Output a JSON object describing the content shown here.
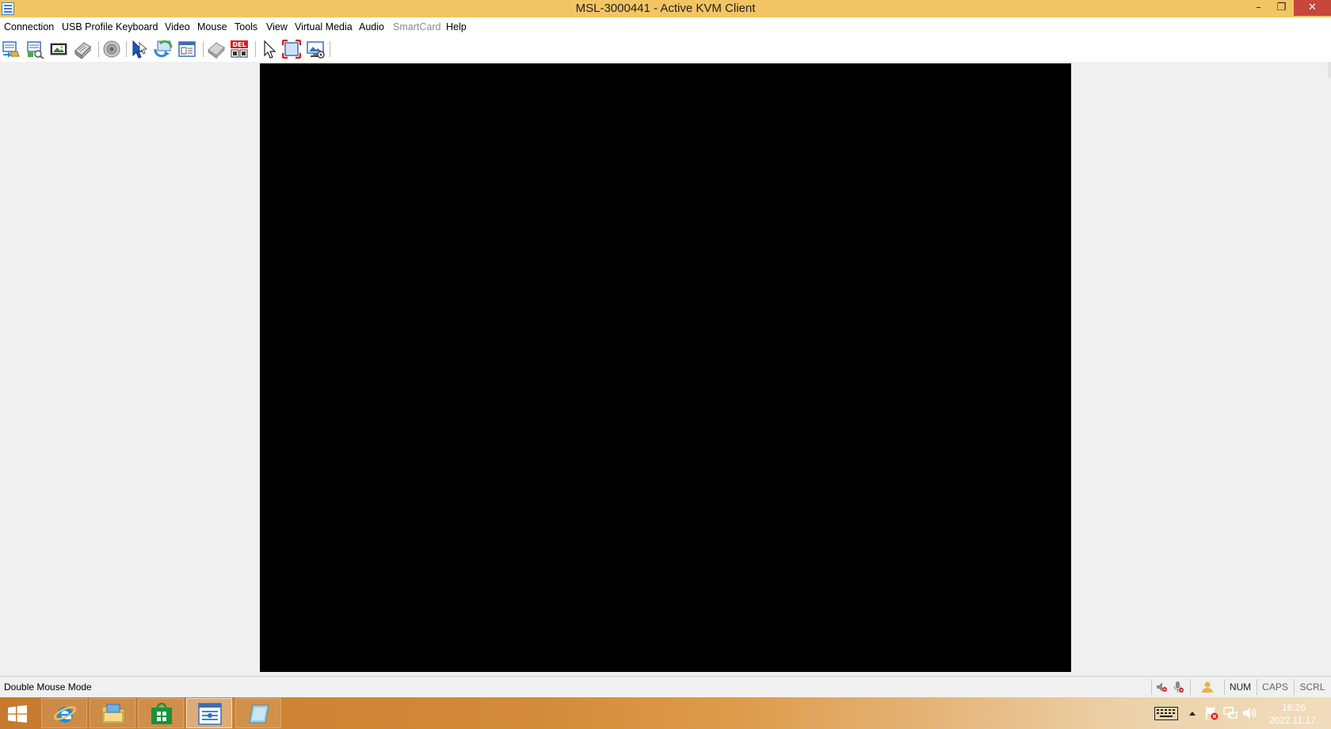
{
  "window": {
    "title": "MSL-3000441 - Active KVM Client",
    "controls": {
      "minimize": "–",
      "maximize": "❐",
      "close": "✕"
    }
  },
  "menu": [
    {
      "id": "connection",
      "label": "Connection",
      "enabled": true
    },
    {
      "id": "usb-profile",
      "label": "USB Profile",
      "enabled": true
    },
    {
      "id": "keyboard",
      "label": "Keyboard",
      "enabled": true
    },
    {
      "id": "video",
      "label": "Video",
      "enabled": true
    },
    {
      "id": "mouse",
      "label": "Mouse",
      "enabled": true
    },
    {
      "id": "tools",
      "label": "Tools",
      "enabled": true
    },
    {
      "id": "view",
      "label": "View",
      "enabled": true
    },
    {
      "id": "virtual-media",
      "label": "Virtual Media",
      "enabled": true
    },
    {
      "id": "audio",
      "label": "Audio",
      "enabled": true
    },
    {
      "id": "smartcard",
      "label": "SmartCard",
      "enabled": false
    },
    {
      "id": "help",
      "label": "Help",
      "enabled": true
    }
  ],
  "toolbar": {
    "icons": [
      "connection-icon",
      "usb-profile-icon",
      "video-settings-icon",
      "keyboard-macro-icon",
      "audio-icon",
      "mouse-mode-icon",
      "refresh-video-icon",
      "calibrate-icon",
      "virtual-media-icon",
      "ctrl-alt-del-icon",
      "single-cursor-icon",
      "full-screen-icon",
      "capture-screen-icon"
    ],
    "ctrl_alt_del_text": "DEL"
  },
  "status": {
    "message": "Double Mouse Mode",
    "indicators": {
      "num": "NUM",
      "caps": "CAPS",
      "scroll": "SCRL"
    }
  },
  "taskbar": {
    "apps": [
      "start-icon",
      "internet-explorer-icon",
      "file-explorer-icon",
      "store-icon",
      "kvm-client-icon",
      "notepad-icon"
    ],
    "clock": {
      "time": "16:26",
      "date": "2022.11.17."
    }
  },
  "colors": {
    "titlebar": "#f2c564",
    "close_button": "#c7473b",
    "remote_screen": "#000000",
    "taskbar": "#d28b38"
  }
}
